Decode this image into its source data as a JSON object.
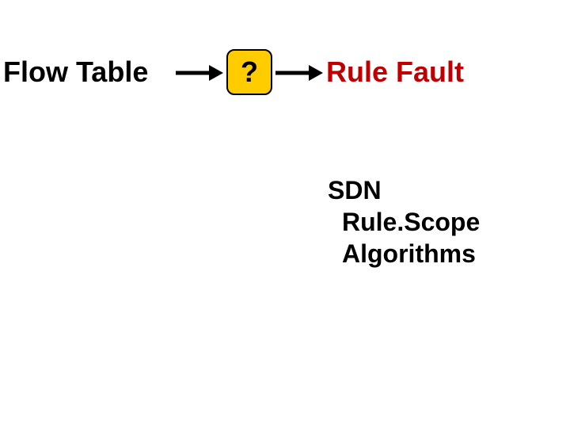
{
  "flow_table_label": "Flow Table",
  "question_mark": "?",
  "rule_fault_label": "Rule Fault",
  "sublist": {
    "item1": "SDN",
    "item2": "Rule.Scope",
    "item3": "Algorithms"
  }
}
